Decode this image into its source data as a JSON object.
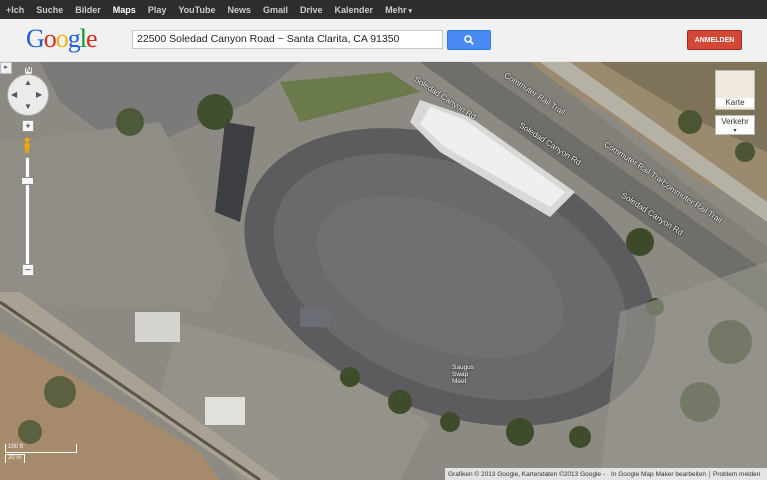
{
  "gbar": {
    "items": [
      "+Ich",
      "Suche",
      "Bilder",
      "Maps",
      "Play",
      "YouTube",
      "News",
      "Gmail",
      "Drive",
      "Kalender",
      "Mehr"
    ],
    "active": "Maps"
  },
  "header": {
    "logo": "Google",
    "search_value": "22500 Soledad Canyon Road ~ Santa Clarita, CA 91350",
    "signin_label": "ANMELDEN"
  },
  "map": {
    "north_label": "N",
    "layer_buttons": {
      "karte": "Karte",
      "verkehr": "Verkehr"
    },
    "road_labels": {
      "soledad_1": "Soledad Canyon Rd",
      "soledad_2": "Soledad Canyon Rd",
      "soledad_3": "Soledad Canyon Rd",
      "trail_1": "Commuter Rail Trail",
      "trail_2": "Commuter Rail Trail",
      "trail_3": "Commuter Rail Trail"
    },
    "place_label": "Saugus Swap Meet",
    "scale": {
      "feet": "100 ft",
      "meters": "20 m"
    },
    "footer": {
      "attribution": "Grafiken © 2013 Google, Kartendaten ©2013 Google -",
      "edit_link": "In Google Map Maker bearbeiten",
      "report_link": "Problem melden"
    }
  },
  "colors": {
    "gbar_bg": "#2d2d2d",
    "search_button": "#4a8af4",
    "signin_button": "#d14836"
  }
}
